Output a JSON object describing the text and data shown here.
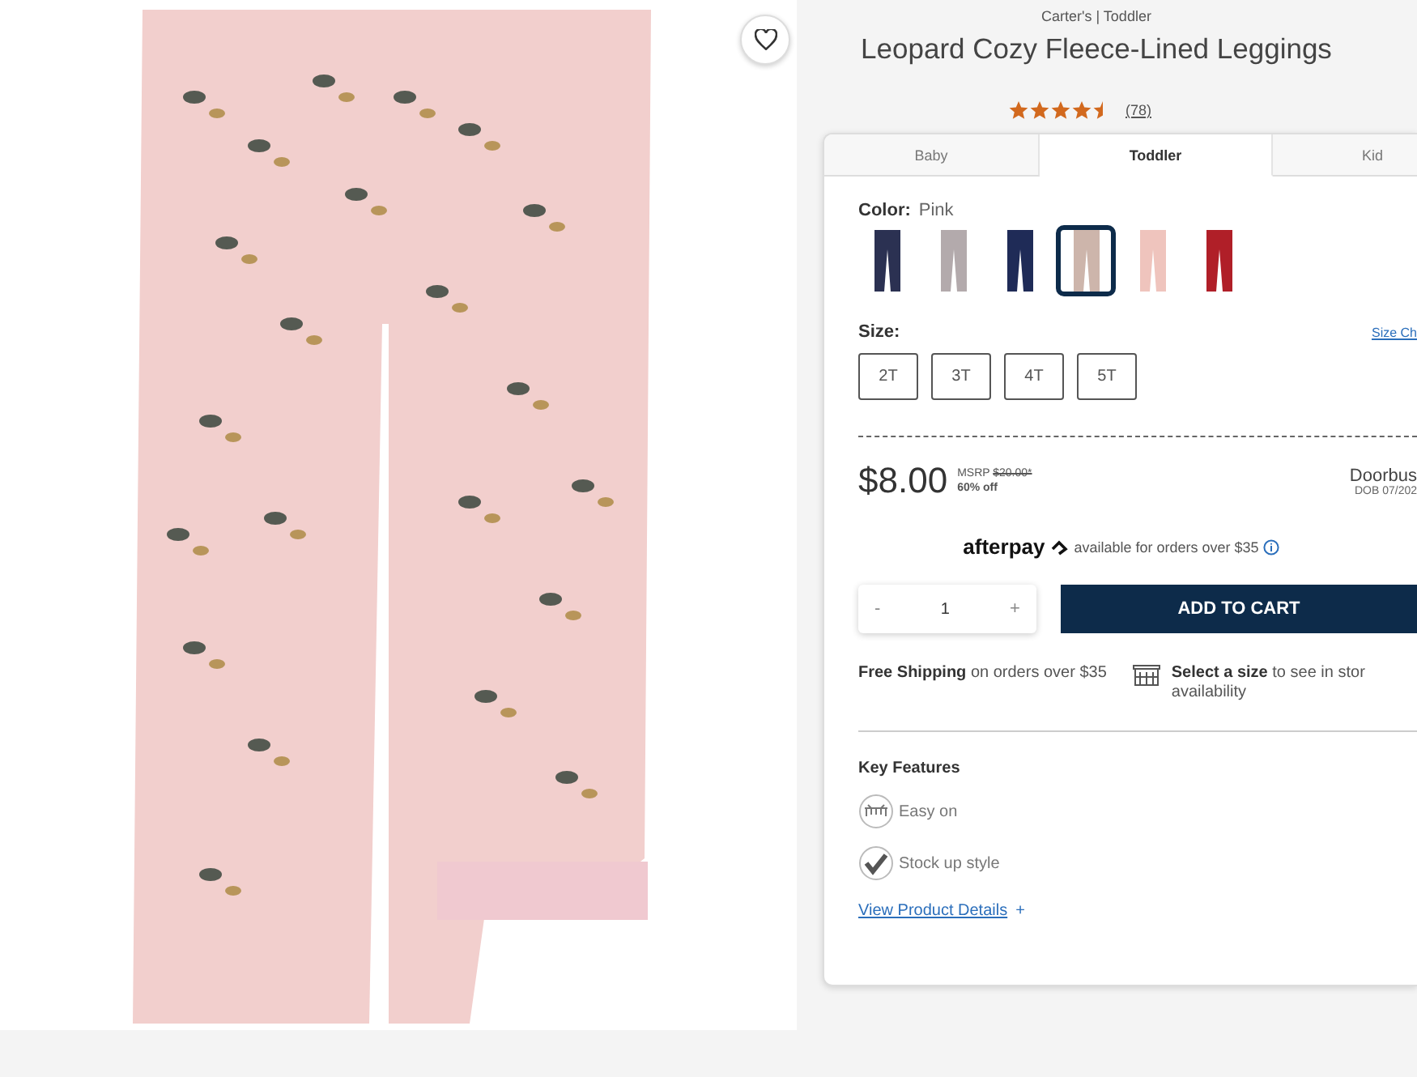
{
  "brand": "Carter's | Toddler",
  "title": "Leopard Cozy Fleece-Lined Leggings",
  "rating": {
    "stars": 4.5,
    "count": "(78)"
  },
  "tabs": [
    {
      "label": "Baby",
      "selected": false
    },
    {
      "label": "Toddler",
      "selected": true
    },
    {
      "label": "Kid",
      "selected": false
    }
  ],
  "color": {
    "label": "Color:",
    "value": "Pink",
    "swatches": [
      {
        "color": "#2b3152",
        "selected": false
      },
      {
        "color": "#b3aaac",
        "selected": false
      },
      {
        "color": "#1f2b57",
        "selected": false
      },
      {
        "color": "#cdb5ab",
        "selected": true
      },
      {
        "color": "#efc4bd",
        "selected": false
      },
      {
        "color": "#b01f28",
        "selected": false
      }
    ]
  },
  "size": {
    "label": "Size:",
    "chart_link": "Size Ch",
    "options": [
      "2T",
      "3T",
      "4T",
      "5T"
    ]
  },
  "price": {
    "current": "$8.00",
    "msrp_label": "MSRP",
    "msrp": "$20.00*",
    "discount": "60% off",
    "badge": "Doorbus",
    "badge_date": "DOB 07/202"
  },
  "afterpay": {
    "logo": "afterpay",
    "text": "available for orders over $35"
  },
  "quantity": {
    "minus": "-",
    "value": "1",
    "plus": "+"
  },
  "add_to_cart": "ADD TO CART",
  "shipping": "**Free Shipping** on orders over $35",
  "store_lines": [
    "**Select a size** to see in stor",
    "availability"
  ],
  "key_features": {
    "title": "Key Features",
    "items": [
      {
        "kind": "easy-on",
        "label": "Easy on"
      },
      {
        "kind": "stock-up",
        "label": "Stock up style"
      }
    ]
  },
  "details_link": {
    "label": "View Product Details",
    "plus": "+"
  }
}
